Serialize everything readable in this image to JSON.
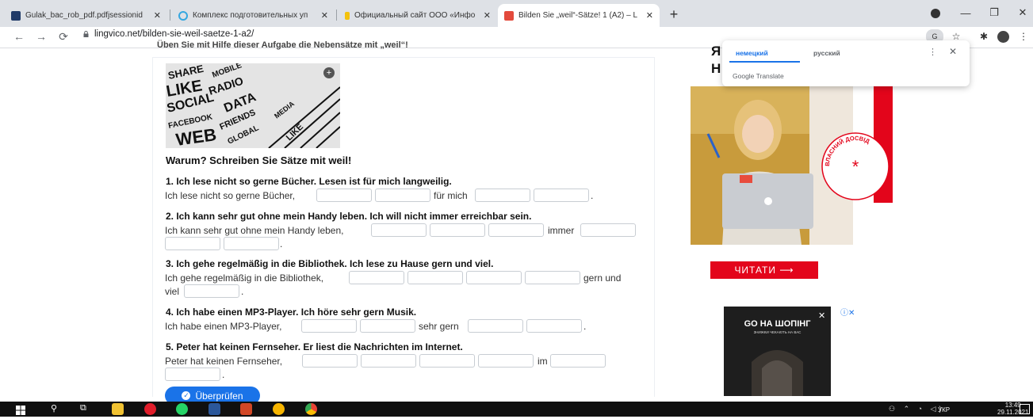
{
  "browser": {
    "tabs": [
      {
        "title": "Gulak_bac_rob_pdf.pdfjsessionid",
        "favicon_color": "#1f3a68"
      },
      {
        "title": "Комплекс подготовительных уп",
        "favicon_color": "#35a7e0"
      },
      {
        "title": "Официальный сайт ООО «Инфо",
        "favicon_color": "#f4c20d"
      },
      {
        "title": "Bilden Sie „weil“-Sätze! 1 (A2) – L",
        "favicon_color": "#e34a3c"
      }
    ],
    "new_tab_label": "+",
    "url": "lingvico.net/bilden-sie-weil-saetze-1-a2/",
    "window_controls": [
      "—",
      "❐",
      "✕"
    ]
  },
  "page": {
    "intro": "Üben Sie mit Hilfe dieser Aufgabe die Nebensätze mit „weil“!",
    "task_heading": "Warum? Schreiben Sie Sätze mit weil!",
    "questions": [
      {
        "prompt": "1. Ich lese nicht so gerne Bücher. Lesen ist  für mich langweilig.",
        "line1_start": "Ich lese nicht so gerne Bücher,",
        "line1_mid": "für mich",
        "line1_end": "."
      },
      {
        "prompt": "2. Ich kann sehr gut ohne mein Handy leben. Ich will nicht immer erreichbar sein.",
        "line1_start": "Ich kann sehr gut ohne mein Handy leben,",
        "line1_mid": "immer",
        "line2_end": "."
      },
      {
        "prompt": "3. Ich gehe regelmäßig in die Bibliothek. Ich lese zu Hause gern und viel.",
        "line1_start": "Ich gehe regelmäßig in die Bibliothek,",
        "line1_mid": "gern und",
        "line2_start": "viel",
        "line2_end": "."
      },
      {
        "prompt": "4. Ich habe einen MP3-Player. Ich höre sehr gern Musik.",
        "line1_start": "Ich habe einen MP3-Player,",
        "line1_mid": "sehr gern",
        "line1_end": "."
      },
      {
        "prompt": "5. Peter hat keinen Fernseher. Er liest die Nachrichten im Internet.",
        "line1_start": "Peter hat keinen Fernseher,",
        "line1_mid": "im",
        "line2_end": "."
      }
    ],
    "check_button": "Überprüfen",
    "hero_plus": "+"
  },
  "sidebar": {
    "letters": [
      "Я",
      "Н"
    ],
    "stamp_text": "ВЛАСНИЙ ДОСВІД",
    "read_button": "ЧИТАТИ ⟶",
    "ad2_title": "GO НА ШОПІНГ",
    "ad2_sub": "ЗНИЖКИ ЧЕКАЮТЬ НА ВАС",
    "ad2_close": "✕",
    "adchoices": "ⓘ✕"
  },
  "translate_popup": {
    "lang_source": "немецкий",
    "lang_target": "русский",
    "menu": "⋮",
    "close": "✕",
    "brand": "Google Translate"
  },
  "taskbar": {
    "tray_lang": "УКР",
    "clock_time": "13:49",
    "clock_date": "29.11.2021"
  }
}
